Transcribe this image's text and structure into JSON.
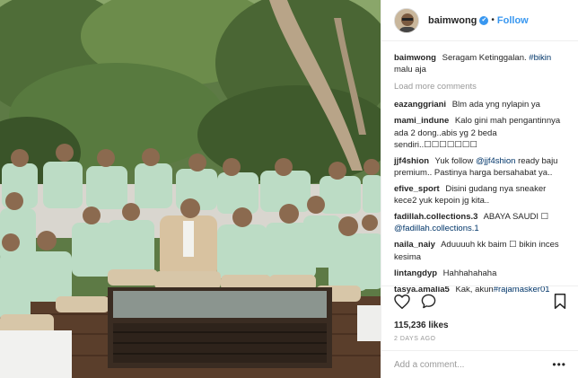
{
  "post": {
    "username": "baimwong",
    "verified_glyph": "✔",
    "separator": "•",
    "follow_label": "Follow",
    "load_more": "Load more comments",
    "caption": {
      "user": "baimwong",
      "text_before": "Seragam Ketinggalan.",
      "hashtag": "#bikin",
      "text_after": "malu aja"
    },
    "comments": [
      {
        "user": "eazanggriani",
        "text": "Blm ada yng nylapin ya"
      },
      {
        "user": "mami_indune",
        "text": "Kalo gini mah pengantinnya ada 2 dong..abis yg 2 beda sendiri..☐☐☐☐☐☐☐"
      },
      {
        "user": "jjf4shion",
        "text_before": "Yuk follow",
        "mention": "@jjf4shion",
        "text_after": "ready baju premium.. Pastinya harga bersahabat ya.."
      },
      {
        "user": "efive_sport",
        "text": "Disini gudang nya sneaker kece2 yuk kepoin jg kita.."
      },
      {
        "user": "fadillah.collections.3",
        "text_before": "ABAYA SAUDI ☐",
        "mention": "@fadillah.collections.1",
        "text_after": ""
      },
      {
        "user": "naila_naiy",
        "text": "Aduuuuh kk baim ☐ bikin inces kesima"
      },
      {
        "user": "lintangdyp",
        "text": "Hahhahahaha"
      },
      {
        "user": "tasya.amalia5",
        "text_before": "Kak, akun",
        "mention": "#rajamasker01",
        "text_after": ""
      }
    ],
    "likes": "115,236 likes",
    "time": "2 DAYS AGO",
    "add_comment_placeholder": "Add a comment...",
    "more_glyph": "•••"
  },
  "icons": {
    "like": "heart-icon",
    "comment": "comment-bubble-icon",
    "save": "bookmark-icon",
    "verified": "verified-badge-icon"
  },
  "colors": {
    "accent": "#3897f0",
    "text": "#262626",
    "muted": "#999999",
    "link": "#003569",
    "shirt": "#bcdcc5"
  }
}
